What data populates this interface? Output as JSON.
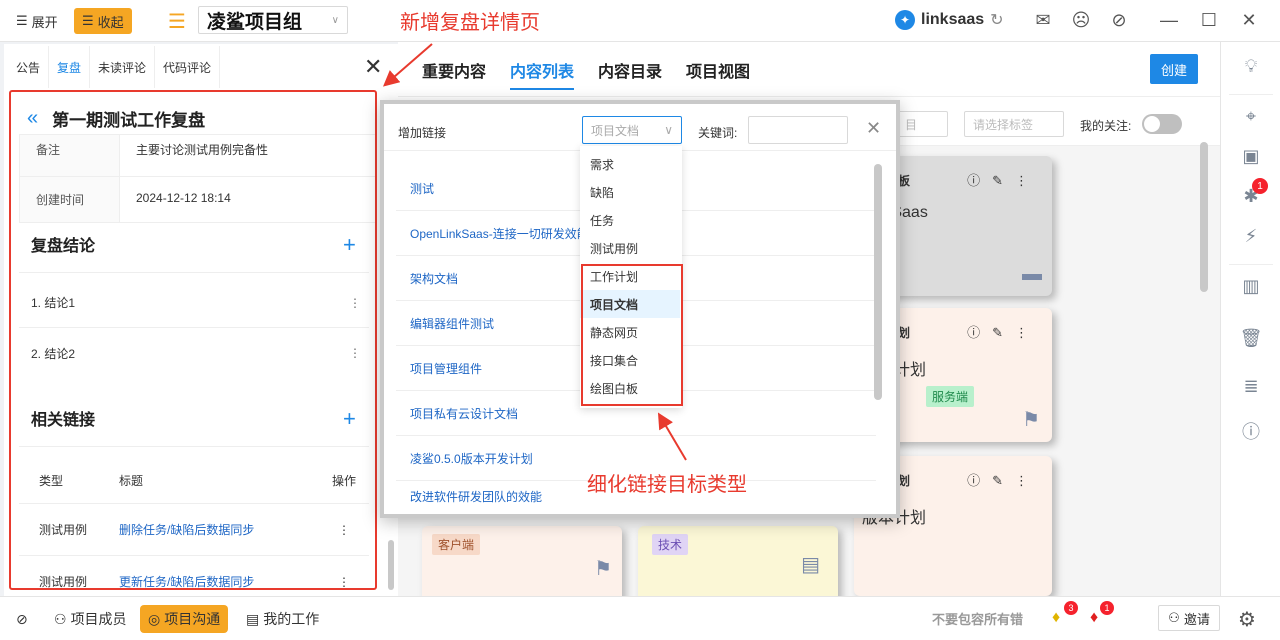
{
  "topbar": {
    "expand_label": "展开",
    "collapse_label": "收起",
    "project_name": "凌鲨项目组",
    "annotation": "新增复盘详情页",
    "brand": "linksaas"
  },
  "left_panel": {
    "tabs": [
      "公告",
      "复盘",
      "未读评论",
      "代码评论"
    ],
    "review_title": "第一期测试工作复盘",
    "info": [
      {
        "key": "备注",
        "value": "主要讨论测试用例完备性"
      },
      {
        "key": "创建时间",
        "value": "2024-12-12 18:14"
      }
    ],
    "conclusion_title": "复盘结论",
    "conclusions": [
      "1.  结论1",
      "2.  结论2"
    ],
    "links_title": "相关链接",
    "links_header": {
      "type": "类型",
      "title": "标题",
      "op": "操作"
    },
    "links": [
      {
        "type": "测试用例",
        "title": "删除任务/缺陷后数据同步"
      },
      {
        "type": "测试用例",
        "title": "更新任务/缺陷后数据同步"
      }
    ]
  },
  "main": {
    "tabs": [
      "重要内容",
      "内容列表",
      "内容目录",
      "项目视图"
    ],
    "create_label": "创建",
    "filter": {
      "tag_placeholder": "请选择标签",
      "follow_label": "我的关注:",
      "first_box_text": "目"
    },
    "cards": [
      {
        "type": "绘图白板",
        "body": "LinkSaas"
      },
      {
        "type": "工作计划",
        "body": "版本计划",
        "tag": "服务端"
      },
      {
        "type": "工作计划",
        "body": "版本计划"
      }
    ],
    "bottom_tags": [
      "客户端",
      "技术"
    ]
  },
  "modal": {
    "title": "增加链接",
    "select_value": "项目文档",
    "keyword_label": "关键词:",
    "rows": [
      "测试",
      "OpenLinkSaas-连接一切研发效能",
      "架构文档",
      "编辑器组件测试",
      "项目管理组件",
      "项目私有云设计文档",
      "凌鲨0.5.0版本开发计划",
      "改进软件研发团队的效能"
    ],
    "dropdown_options": [
      "需求",
      "缺陷",
      "任务",
      "测试用例",
      "工作计划",
      "项目文档",
      "静态网页",
      "接口集合",
      "绘图白板"
    ],
    "dropdown_selected": "项目文档",
    "annotation": "细化链接目标类型"
  },
  "right_sidebar": {
    "bug_badge": "1"
  },
  "bottombar": {
    "items": [
      "项目成员",
      "项目沟通",
      "我的工作"
    ],
    "marquee": "不要包容所有错",
    "badge1": "3",
    "badge2": "1",
    "invite_label": "邀请"
  },
  "colors": {
    "accent": "#1e88e5",
    "orange": "#f5a623",
    "annotation_red": "#e83a2e"
  }
}
